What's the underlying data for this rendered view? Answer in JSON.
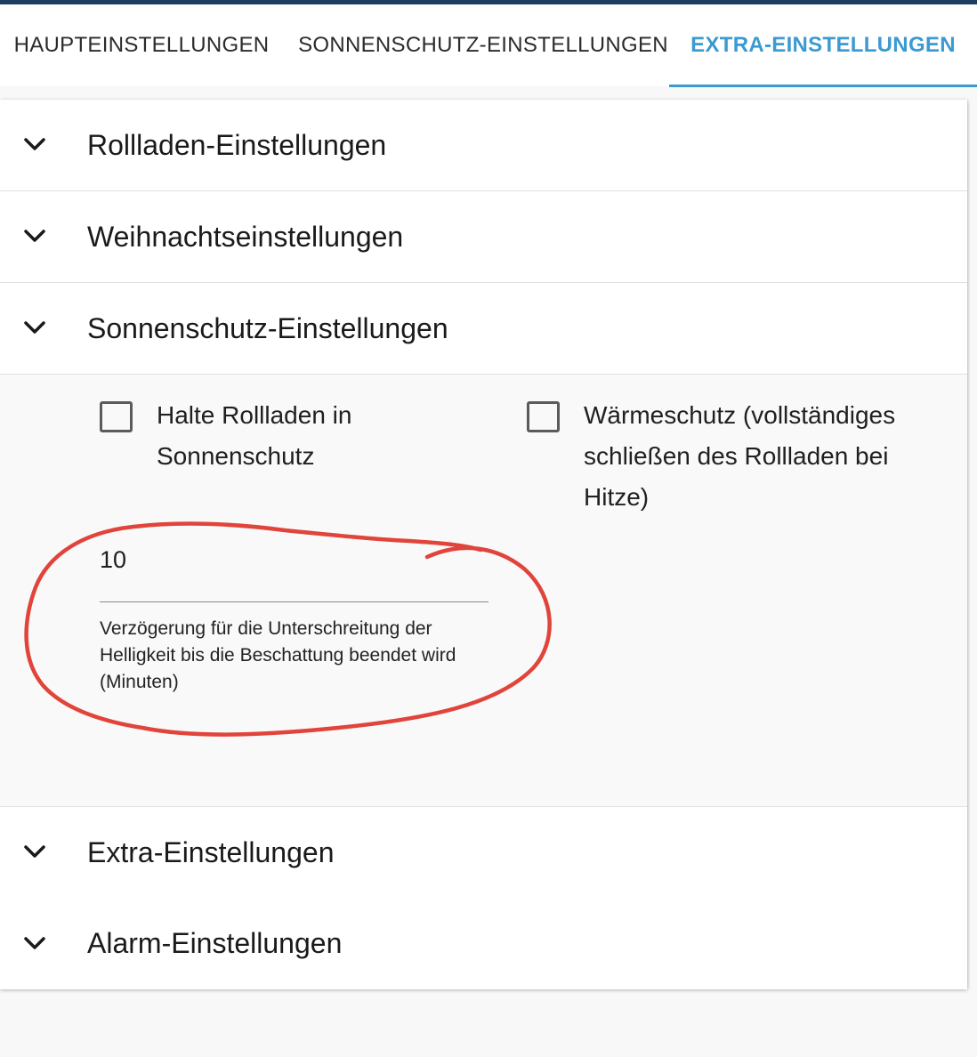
{
  "tabs": [
    {
      "label": "HAUPTEINSTELLUNGEN",
      "active": false
    },
    {
      "label": "SONNENSCHUTZ-EINSTELLUNGEN",
      "active": false
    },
    {
      "label": "EXTRA-EINSTELLUNGEN",
      "active": true
    }
  ],
  "sections": [
    {
      "title": "Rollladen-Einstellungen",
      "expanded": false
    },
    {
      "title": "Weihnachtseinstellungen",
      "expanded": false
    },
    {
      "title": "Sonnenschutz-Einstellungen",
      "expanded": true
    },
    {
      "title": "Extra-Einstellungen",
      "expanded": false
    },
    {
      "title": "Alarm-Einstellungen",
      "expanded": false
    }
  ],
  "sun_settings": {
    "hold_shutter": {
      "label": "Halte Rollladen in Sonnenschutz",
      "checked": false
    },
    "heat_protection": {
      "label": "Wärmeschutz (vollständiges schließen des Rollladen bei Hitze)",
      "checked": false
    },
    "delay": {
      "value": "10",
      "helper": "Verzögerung für die Unterschreitung der Helligkeit bis die Beschattung beendet wird (Minuten)"
    }
  },
  "colors": {
    "accent": "#3b9ad1",
    "top_bar": "#1f3d63",
    "annotation": "#e0443a"
  },
  "icons": {
    "section_toggle": "chevron-down-icon"
  }
}
